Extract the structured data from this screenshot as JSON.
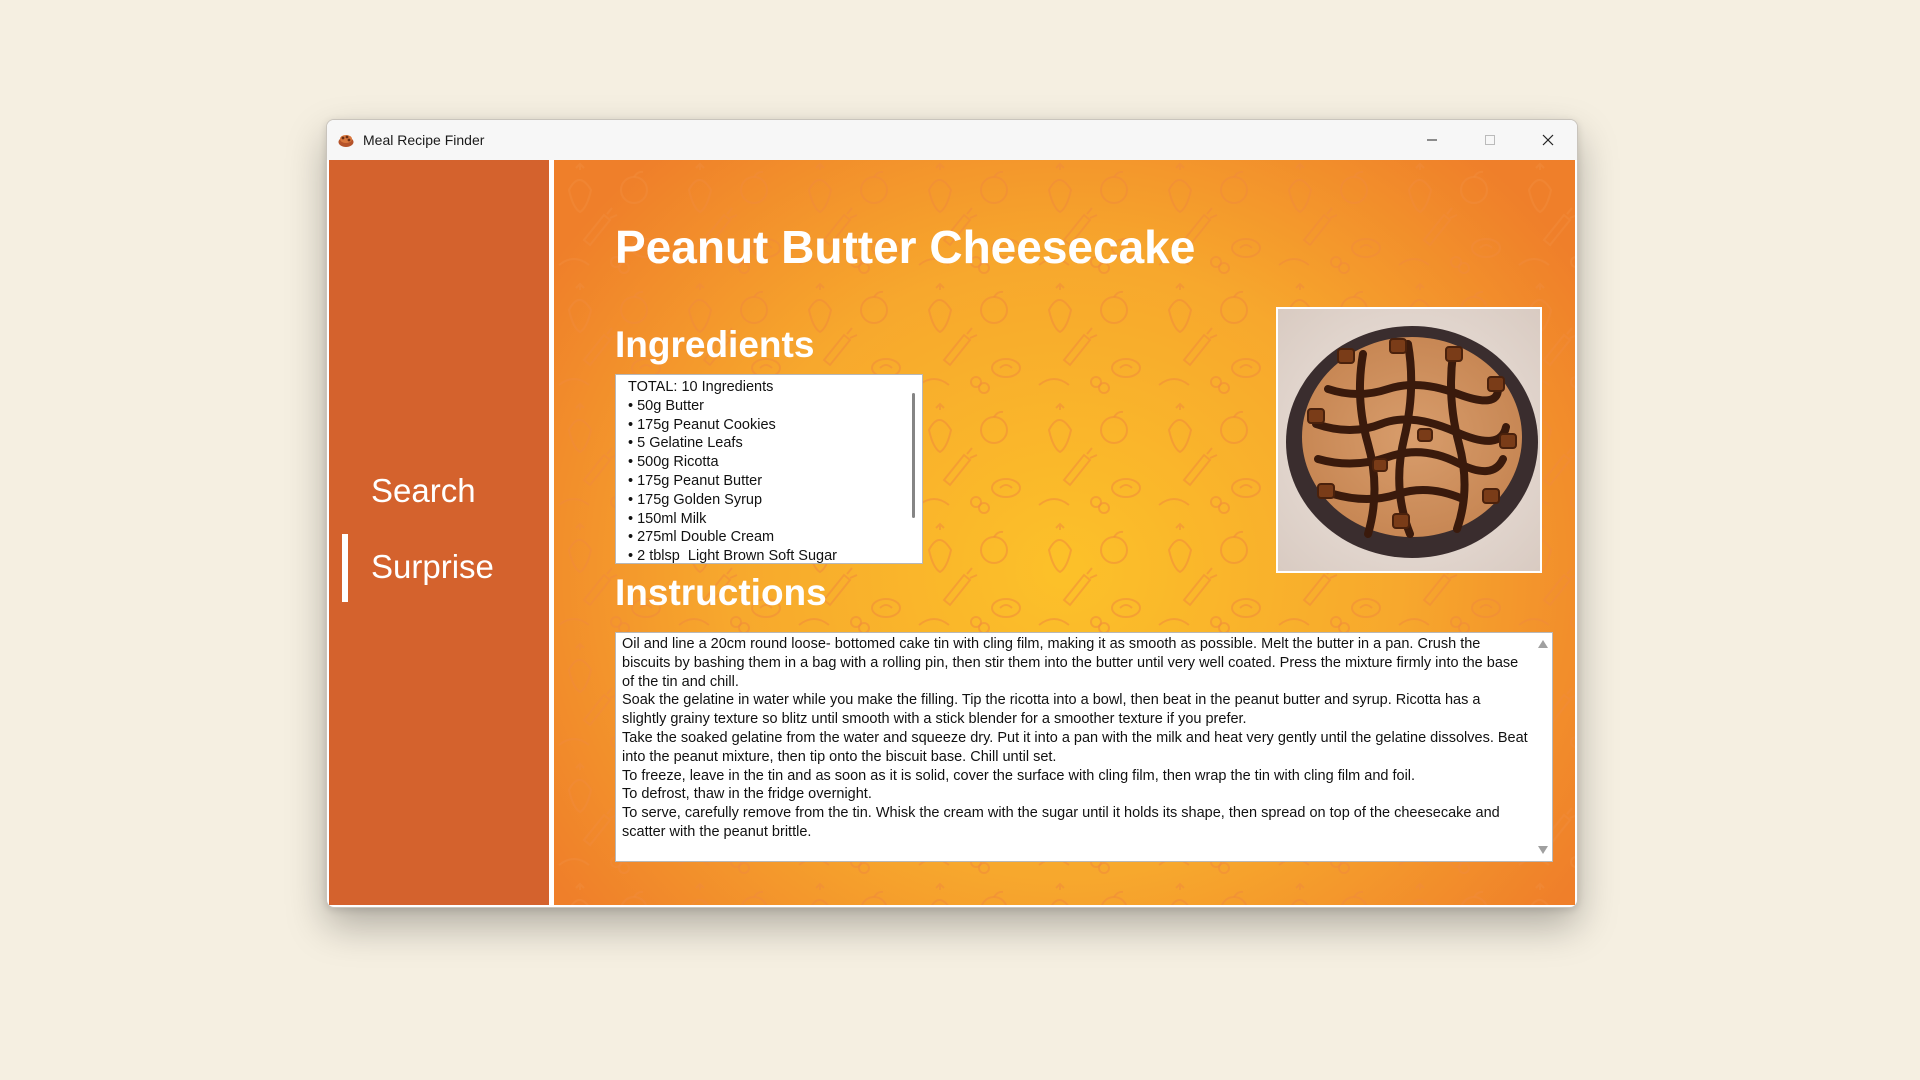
{
  "window": {
    "title": "Meal Recipe Finder",
    "controls": [
      "minimize",
      "maximize",
      "close"
    ]
  },
  "sidebar": {
    "items": [
      {
        "label": "Search",
        "active": false
      },
      {
        "label": "Surprise",
        "active": true
      }
    ]
  },
  "recipe": {
    "title": "Peanut Butter Cheesecake",
    "ingredients_heading": "Ingredients",
    "instructions_heading": "Instructions",
    "ingredients": [
      "TOTAL: 10 Ingredients",
      "• 50g Butter",
      "• 175g Peanut Cookies",
      "• 5 Gelatine Leafs",
      "• 500g Ricotta",
      "• 175g Peanut Butter",
      "• 175g Golden Syrup",
      "• 150ml Milk",
      "• 275ml Double Cream",
      "• 2 tblsp  Light Brown Soft Sugar"
    ],
    "instructions": [
      "Oil and line a 20cm round loose- bottomed cake tin with cling film, making it as smooth as possible. Melt the butter in a pan. Crush the biscuits by bashing them in a bag with a rolling pin, then stir them into the butter until very well coated. Press the mixture firmly into the base of the tin and chill.",
      "Soak the gelatine in water while you make the filling. Tip the ricotta into a bowl, then beat in the peanut butter and syrup. Ricotta has a slightly grainy texture so blitz until smooth with a stick blender for a smoother texture if you prefer.",
      "Take the soaked gelatine from the water and squeeze dry. Put it into a pan with the milk and heat very gently until the gelatine dissolves. Beat into the peanut mixture, then tip onto the biscuit base. Chill until set.",
      "To freeze, leave in the tin and as soon as it is solid, cover the surface with cling film, then wrap the tin with cling film and foil.",
      "To defrost, thaw in the fridge overnight.",
      "To serve, carefully remove from the tin. Whisk the cream with the sugar until it holds its shape, then spread on top of the cheesecake and scatter with the peanut brittle."
    ]
  },
  "colors": {
    "sidebar": "#d4622d",
    "background_center": "#fcc129",
    "background_edge": "#ef7f2a",
    "desktop": "#f5efe1"
  }
}
